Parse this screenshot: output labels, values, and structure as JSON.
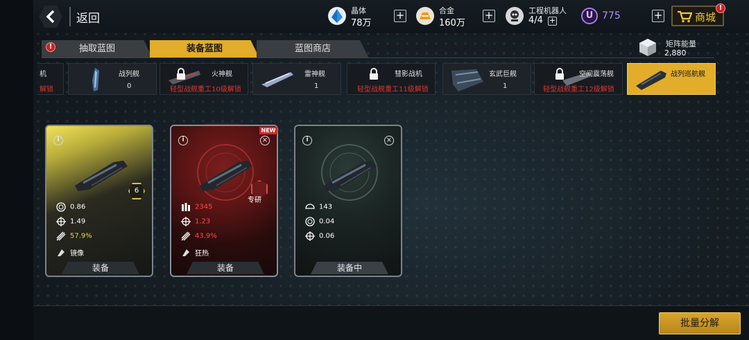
{
  "header": {
    "back_label": "返回",
    "resources": [
      {
        "name": "晶体",
        "value": "78万",
        "icon": "crystal-icon",
        "color": "#3ea0e8"
      },
      {
        "name": "合金",
        "value": "160万",
        "icon": "alloy-icon",
        "color": "#f0a020"
      },
      {
        "name": "工程机器人",
        "value": "4/4",
        "icon": "robot-icon",
        "color": "#e0e0e0"
      }
    ],
    "u_currency": {
      "symbol": "U",
      "value": "775",
      "color": "#b68dff"
    },
    "shop_label": "商城",
    "shop_badge": "!"
  },
  "tabs": [
    {
      "label": "抽取蓝图",
      "badge": "!",
      "active": false
    },
    {
      "label": "装备蓝图",
      "active": true
    },
    {
      "label": "蓝图商店",
      "active": false
    }
  ],
  "matrix_energy": {
    "name": "矩阵能量",
    "value": "2,880"
  },
  "ship_types": [
    {
      "name": "机",
      "lock_text": "解锁",
      "locked": true
    },
    {
      "name": "战列舰",
      "count": "0",
      "locked": false
    },
    {
      "name": "火神舰",
      "lock_text": "轻型战舰重工10级解锁",
      "locked": true
    },
    {
      "name": "雷神舰",
      "count": "1",
      "locked": false
    },
    {
      "name": "彗影战机",
      "lock_text": "轻型战舰重工11级解锁",
      "locked": true
    },
    {
      "name": "玄武巨舰",
      "count": "1",
      "locked": false
    },
    {
      "name": "空间震荡舰",
      "lock_text": "轻型战舰重工12级解锁",
      "locked": true
    },
    {
      "name": "战列巡航舰",
      "active": true
    }
  ],
  "cards": [
    {
      "rarity": "gold",
      "level": "6",
      "stats": [
        {
          "icon": "target-ring-icon",
          "value": "0.86"
        },
        {
          "icon": "crosshair-icon",
          "value": "1.49"
        },
        {
          "icon": "missile-icon",
          "value": "57.9%",
          "color": "#f2d03a"
        },
        {
          "icon": "skill-icon",
          "value": "镜像"
        }
      ],
      "button": "装备"
    },
    {
      "rarity": "red",
      "new_tag": "NEW",
      "research_label": "专研",
      "stats": [
        {
          "icon": "ammo-icon",
          "value": "2345",
          "color": "#ff4a4a"
        },
        {
          "icon": "crosshair-icon",
          "value": "1.23",
          "color": "#ff4a4a"
        },
        {
          "icon": "missile-icon",
          "value": "43.9%",
          "color": "#ff4a4a"
        },
        {
          "icon": "skill-icon",
          "value": "狂热"
        }
      ],
      "button": "装备"
    },
    {
      "rarity": "gray",
      "stats": [
        {
          "icon": "shield-icon",
          "value": "143"
        },
        {
          "icon": "target-ring-icon",
          "value": "0.04"
        },
        {
          "icon": "crosshair-icon",
          "value": "0.06"
        }
      ],
      "button": "装备中"
    }
  ],
  "batch_button": "批量分解"
}
